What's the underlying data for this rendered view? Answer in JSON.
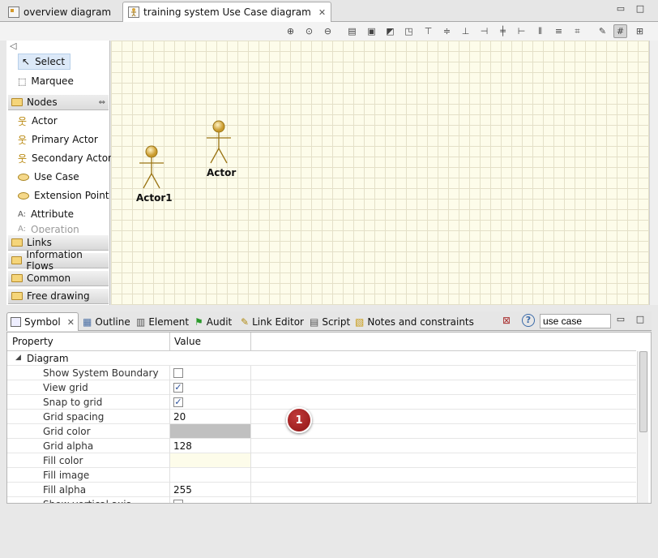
{
  "editor_tabs": [
    {
      "label": "overview diagram",
      "active": false
    },
    {
      "label": "training system Use Case diagram",
      "active": true,
      "close": "✕"
    }
  ],
  "palette": {
    "tools": [
      {
        "label": "Select",
        "icon": "arrow-pointer-icon",
        "selected": true
      },
      {
        "label": "Marquee",
        "icon": "marquee-icon",
        "selected": false
      }
    ],
    "nodes_drawer": "Nodes",
    "nodes": [
      {
        "label": "Actor",
        "icon": "actor-icon"
      },
      {
        "label": "Primary Actor",
        "icon": "primary-actor-icon"
      },
      {
        "label": "Secondary Actor",
        "icon": "secondary-actor-icon"
      },
      {
        "label": "Use Case",
        "icon": "use-case-icon"
      },
      {
        "label": "Extension Point",
        "icon": "extension-point-icon"
      },
      {
        "label": "Attribute",
        "icon": "attribute-icon"
      },
      {
        "label": "Operation",
        "icon": "operation-icon"
      }
    ],
    "drawers": [
      "Links",
      "Information Flows",
      "Common",
      "Free drawing"
    ]
  },
  "canvas": {
    "actors": [
      {
        "label": "Actor1"
      },
      {
        "label": "Actor"
      }
    ]
  },
  "view_tabs": [
    {
      "label": "Symbol",
      "icon": "symbol-icon",
      "active": true,
      "close": "✕"
    },
    {
      "label": "Outline",
      "icon": "outline-icon"
    },
    {
      "label": "Element",
      "icon": "element-icon"
    },
    {
      "label": "Audit",
      "icon": "flag-icon"
    },
    {
      "label": "Link Editor",
      "icon": "pencil-icon"
    },
    {
      "label": "Script",
      "icon": "script-icon"
    },
    {
      "label": "Notes and constraints",
      "icon": "notes-icon"
    }
  ],
  "filter": {
    "value": "use case"
  },
  "properties": {
    "header_property": "Property",
    "header_value": "Value",
    "group": "Diagram",
    "rows": [
      {
        "name": "Show System Boundary",
        "type": "checkbox",
        "checked": false
      },
      {
        "name": "View grid",
        "type": "checkbox",
        "checked": true
      },
      {
        "name": "Snap to grid",
        "type": "checkbox",
        "checked": true
      },
      {
        "name": "Grid spacing",
        "type": "text",
        "value": "20"
      },
      {
        "name": "Grid color",
        "type": "color",
        "color": "#c0c0c0"
      },
      {
        "name": "Grid alpha",
        "type": "text",
        "value": "128"
      },
      {
        "name": "Fill color",
        "type": "color",
        "color": "#fdfcea"
      },
      {
        "name": "Fill image",
        "type": "text",
        "value": ""
      },
      {
        "name": "Fill alpha",
        "type": "text",
        "value": "255"
      },
      {
        "name": "Show vertical axis",
        "type": "checkbox",
        "checked": false
      }
    ]
  },
  "callout_marker": "1",
  "colors": {
    "accent_marker": "#a01f1f",
    "canvas_bg": "#fdfcea",
    "grid_line": "#e4e0c8"
  }
}
